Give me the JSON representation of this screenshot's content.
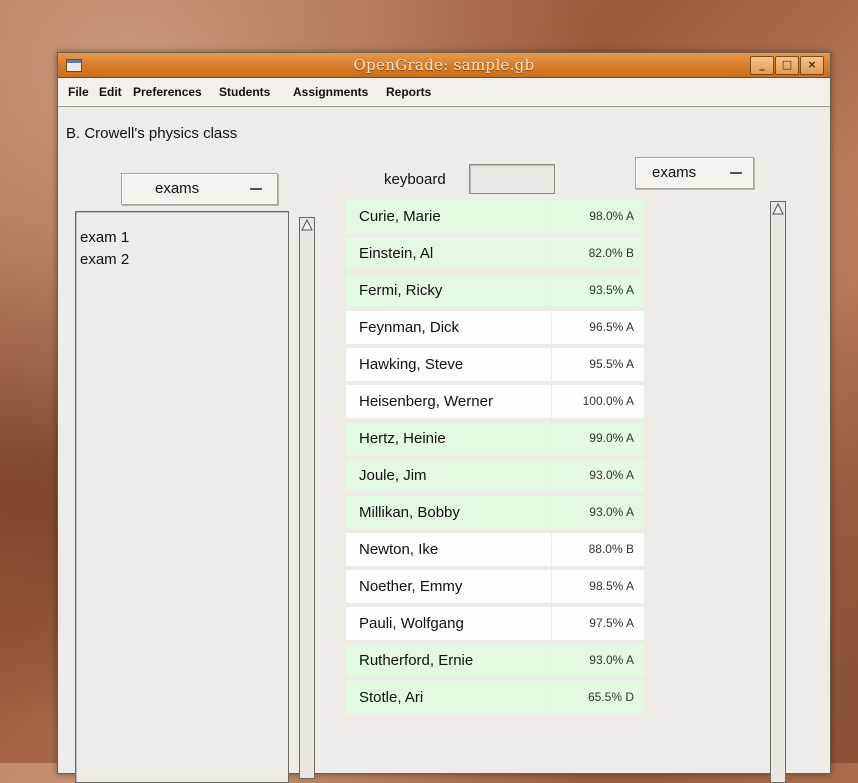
{
  "window": {
    "title": "OpenGrade: sample.gb",
    "controls": [
      "_",
      "□",
      "×"
    ]
  },
  "menu": [
    "File",
    "Edit",
    "Preferences",
    "Students",
    "Assignments",
    "Reports"
  ],
  "class_name": "B. Crowell's physics class",
  "left_panel": {
    "category_select": "exams",
    "assignments": [
      "exam 1",
      "exam 2"
    ]
  },
  "keyboard": {
    "label": "keyboard",
    "value": ""
  },
  "right_panel": {
    "category_select": "exams"
  },
  "students": [
    {
      "name": "Curie, Marie",
      "grade": "98.0% A",
      "highlight": true
    },
    {
      "name": "Einstein, Al",
      "grade": "82.0% B",
      "highlight": true
    },
    {
      "name": "Fermi, Ricky",
      "grade": "93.5% A",
      "highlight": true
    },
    {
      "name": "Feynman, Dick",
      "grade": "96.5% A",
      "highlight": false
    },
    {
      "name": "Hawking, Steve",
      "grade": "95.5% A",
      "highlight": false
    },
    {
      "name": "Heisenberg, Werner",
      "grade": "100.0% A",
      "highlight": false
    },
    {
      "name": "Hertz, Heinie",
      "grade": "99.0% A",
      "highlight": true
    },
    {
      "name": "Joule, Jim",
      "grade": "93.0% A",
      "highlight": true
    },
    {
      "name": "Millikan, Bobby",
      "grade": "93.0% A",
      "highlight": true
    },
    {
      "name": "Newton, Ike",
      "grade": "88.0% B",
      "highlight": false
    },
    {
      "name": "Noether, Emmy",
      "grade": "98.5% A",
      "highlight": false
    },
    {
      "name": "Pauli, Wolfgang",
      "grade": "97.5% A",
      "highlight": false
    },
    {
      "name": "Rutherford, Ernie",
      "grade": "93.0% A",
      "highlight": true
    },
    {
      "name": "Stotle, Ari",
      "grade": "65.5% D",
      "highlight": true
    }
  ],
  "colors": {
    "titlebar": "#d67a2a",
    "row_highlight": "#e3f9e1",
    "row_plain": "#fdfdfd"
  }
}
